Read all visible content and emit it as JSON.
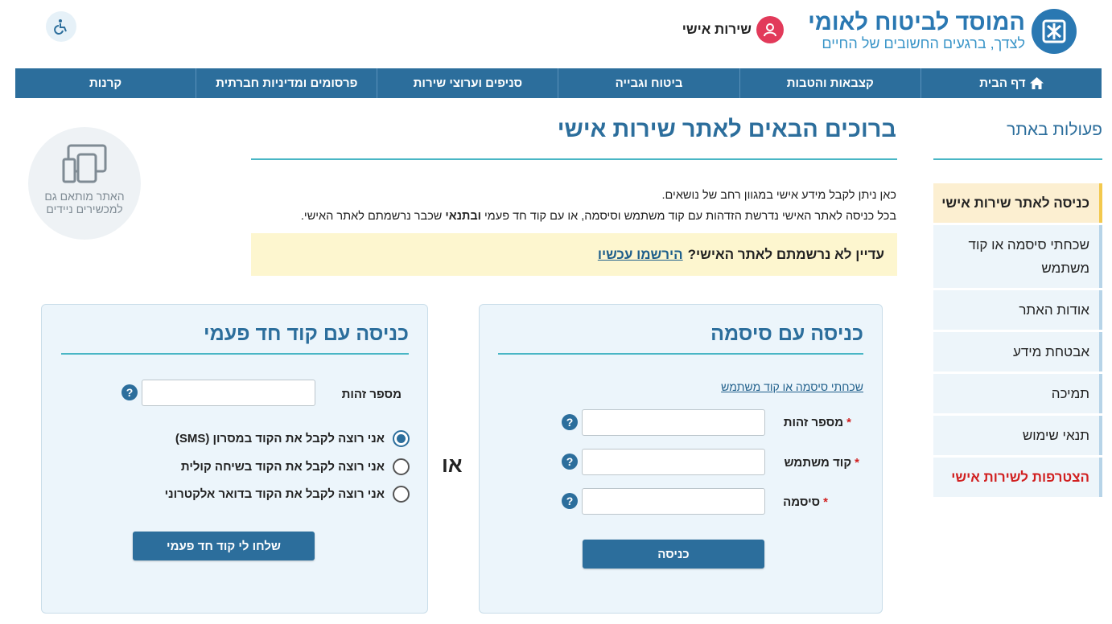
{
  "header": {
    "org_title": "המוסד לביטוח לאומי",
    "org_subtitle": "לצדך, ברגעים החשובים של החיים",
    "personal_service_label": "שירות אישי",
    "logo_icon": "nii-logo-icon",
    "accessibility_icon": "wheelchair-icon"
  },
  "nav": {
    "items": [
      {
        "label": "דף הבית",
        "icon": "home-icon"
      },
      {
        "label": "קצבאות והטבות"
      },
      {
        "label": "ביטוח וגבייה"
      },
      {
        "label": "סניפים וערוצי שירות"
      },
      {
        "label": "פרסומים ומדיניות חברתית"
      },
      {
        "label": "קרנות"
      }
    ]
  },
  "sidebar": {
    "title": "פעולות באתר",
    "items": [
      {
        "label": "כניסה לאתר שירות אישי"
      },
      {
        "label": "שכחתי סיסמה או קוד משתמש"
      },
      {
        "label": "אודות האתר"
      },
      {
        "label": "אבטחת מידע"
      },
      {
        "label": "תמיכה"
      },
      {
        "label": "תנאי שימוש"
      },
      {
        "label": "הצטרפות לשירות אישי"
      }
    ]
  },
  "main": {
    "title": "ברוכים הבאים לאתר שירות אישי",
    "intro_line1": "כאן ניתן לקבל מידע אישי במגוון רחב של נושאים.",
    "intro_line2_a": "בכל כניסה לאתר האישי נדרשת הזדהות עם קוד משתמש וסיסמה, או עם קוד חד פעמי ",
    "intro_line2_bold": "ובתנאי",
    "intro_line2_b": " שכבר נרשמתם לאתר האישי.",
    "notice_text": "עדיין לא נרשמתם לאתר האישי?",
    "notice_link": "הירשמו עכשיו",
    "mobile_label": "האתר מותאם גם למכשירים ניידים",
    "or_label": "או"
  },
  "password_login": {
    "title": "כניסה עם סיסמה",
    "forgot_link": "שכחתי סיסמה או קוד משתמש",
    "id_label": "מספר זהות",
    "user_code_label": "קוד משתמש",
    "password_label": "סיסמה",
    "required_mark": "*",
    "id_value": "",
    "user_code_value": "",
    "password_value": "",
    "submit_label": "כניסה"
  },
  "otp_login": {
    "title": "כניסה עם קוד חד פעמי",
    "id_label": "מספר זהות",
    "id_value": "",
    "options": [
      {
        "label": "אני רוצה לקבל את הקוד במסרון (SMS)",
        "selected": true
      },
      {
        "label": "אני רוצה לקבל את הקוד בשיחה קולית",
        "selected": false
      },
      {
        "label": "אני רוצה לקבל את הקוד בדואר אלקטרוני",
        "selected": false
      }
    ],
    "submit_label": "שלחו לי קוד חד פעמי"
  },
  "colors": {
    "brand_blue": "#2c6e9c",
    "accent_teal": "#49b6c5",
    "personal_red": "#e23a5a",
    "notice_bg": "#fdf6cf",
    "active_bg": "#fcefd1",
    "join_red": "#d12020"
  }
}
